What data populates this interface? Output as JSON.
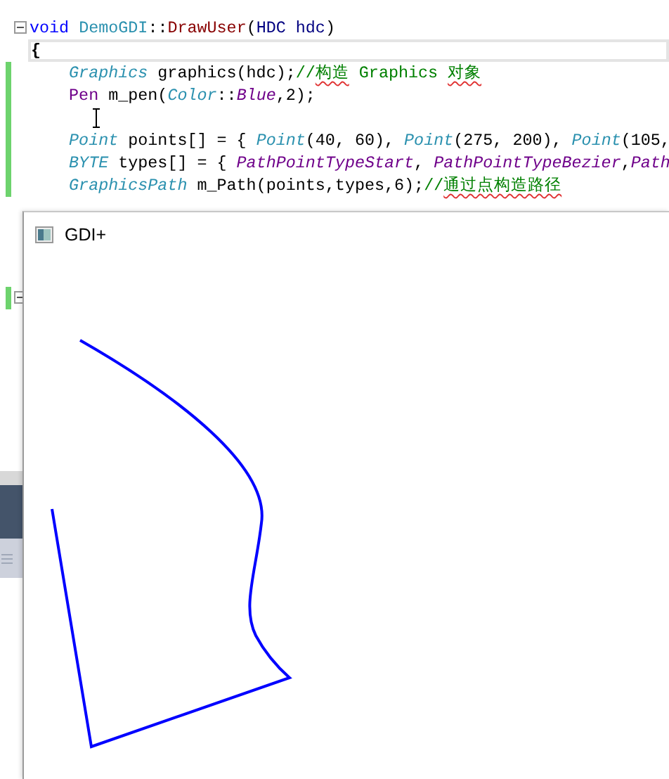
{
  "editor": {
    "lines": [
      {
        "foldable": true,
        "changed": false,
        "current": false,
        "indented": false,
        "tokens": [
          {
            "kind": "keyword",
            "text": "void"
          },
          {
            "kind": "class",
            "text": "DemoGDI",
            "spaced": true
          },
          {
            "kind": "plain",
            "text": "::"
          },
          {
            "kind": "function",
            "text": "DrawUser"
          },
          {
            "kind": "plain",
            "text": "("
          },
          {
            "kind": "param",
            "text": "HDC hdc"
          },
          {
            "kind": "plain",
            "text": ")"
          }
        ]
      },
      {
        "foldable": false,
        "changed": false,
        "current": true,
        "indented": false,
        "tokens": [
          {
            "kind": "bold",
            "text": "{"
          }
        ]
      },
      {
        "foldable": false,
        "changed": true,
        "current": false,
        "indented": true,
        "tokens": [
          {
            "kind": "type",
            "text": "Graphics"
          },
          {
            "kind": "plain",
            "text": "graphics(hdc);",
            "spaced": true
          },
          {
            "kind": "comment",
            "text": "//"
          },
          {
            "kind": "comment",
            "text": "构造",
            "squiggle": true
          },
          {
            "kind": "comment",
            "text": "Graphics",
            "spaced": true
          },
          {
            "kind": "comment",
            "text": "对象",
            "squiggle": true,
            "spaced": true
          }
        ]
      },
      {
        "foldable": false,
        "changed": true,
        "current": false,
        "indented": true,
        "tokens": [
          {
            "kind": "macro",
            "text": "Pen"
          },
          {
            "kind": "plain",
            "text": "m_pen(",
            "spaced": true
          },
          {
            "kind": "type",
            "text": "Color"
          },
          {
            "kind": "plain",
            "text": "::"
          },
          {
            "kind": "enum",
            "text": "Blue"
          },
          {
            "kind": "plain",
            "text": ",2);"
          }
        ]
      },
      {
        "foldable": false,
        "changed": true,
        "current": false,
        "indented": false
      },
      {
        "foldable": false,
        "changed": true,
        "current": false,
        "indented": true,
        "tokens": [
          {
            "kind": "type",
            "text": "Point"
          },
          {
            "kind": "plain",
            "text": "points[] = {",
            "spaced": true
          },
          {
            "kind": "type",
            "text": "Point",
            "spaced": true
          },
          {
            "kind": "plain",
            "text": "(40, 60),"
          },
          {
            "kind": "type",
            "text": "Point",
            "spaced": true
          },
          {
            "kind": "plain",
            "text": "(275, 200),"
          },
          {
            "kind": "type",
            "text": "Point",
            "spaced": true
          },
          {
            "kind": "plain",
            "text": "(105,"
          }
        ]
      },
      {
        "foldable": false,
        "changed": true,
        "current": false,
        "indented": true,
        "tokens": [
          {
            "kind": "type",
            "text": "BYTE"
          },
          {
            "kind": "plain",
            "text": "types[] = {",
            "spaced": true
          },
          {
            "kind": "enum",
            "text": "PathPointTypeStart",
            "spaced": true
          },
          {
            "kind": "plain",
            "text": ","
          },
          {
            "kind": "enum",
            "text": "PathPointTypeBezier",
            "spaced": true
          },
          {
            "kind": "plain",
            "text": ","
          },
          {
            "kind": "enum",
            "text": "Path"
          }
        ]
      },
      {
        "foldable": false,
        "changed": true,
        "current": false,
        "indented": true,
        "tokens": [
          {
            "kind": "type",
            "text": "GraphicsPath"
          },
          {
            "kind": "plain",
            "text": "m_Path(points,types,6);",
            "spaced": true
          },
          {
            "kind": "comment",
            "text": "//"
          },
          {
            "kind": "comment",
            "text": "通过点构造路径",
            "squiggle": true
          }
        ]
      },
      {
        "foldable": false,
        "changed": false,
        "current": false,
        "indented": false
      },
      {
        "foldable": false,
        "changed": false,
        "current": false,
        "indented": false
      },
      {
        "foldable": false,
        "changed": false,
        "current": false,
        "indented": false
      },
      {
        "foldable": false,
        "changed": false,
        "current": false,
        "indented": false
      },
      {
        "foldable": true,
        "changed": true,
        "current": false,
        "indented": false
      }
    ]
  },
  "window": {
    "title": "GDI+"
  }
}
